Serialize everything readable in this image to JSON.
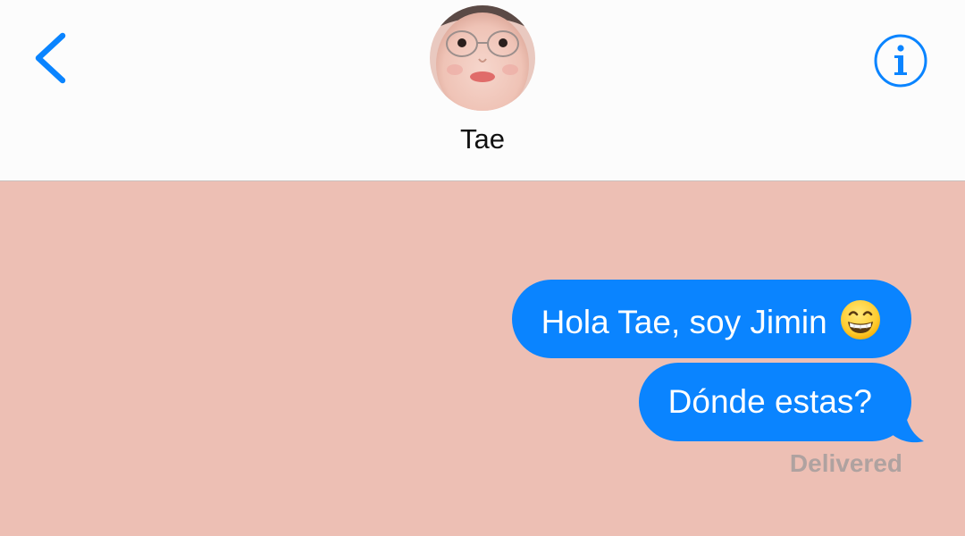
{
  "header": {
    "back_icon": "chevron-left-icon",
    "contact_name": "Tae",
    "info_icon": "info-icon",
    "accent_color": "#0A84FF"
  },
  "conversation": {
    "background_color": "#EDBFB4",
    "messages": [
      {
        "text": "Hola Tae, soy Jimin",
        "emoji": "grinning-face-icon",
        "sender": "me"
      },
      {
        "text": "Dónde estas?",
        "sender": "me"
      }
    ],
    "status": "Delivered"
  }
}
